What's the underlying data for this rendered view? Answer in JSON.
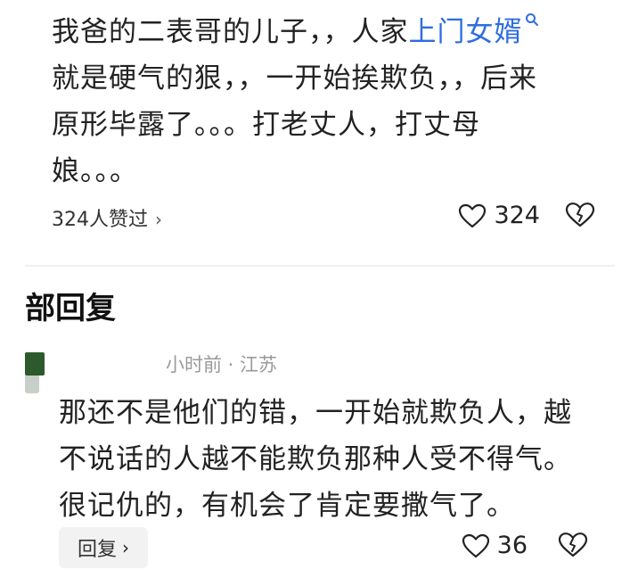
{
  "top_comment": {
    "line1": "我爸的二表哥的儿子，，人家",
    "link": "上门女婿",
    "line2": "就是硬气的狠，，一开始挨欺负，，后来",
    "line3": "原形毕露了。。。打老丈人，打丈母",
    "line4": "娘。。。",
    "likers_label": "324人赞过",
    "likes_count": "324"
  },
  "section_title": "部回复",
  "reply": {
    "meta": "小时前 · 江苏",
    "line1": "那还不是他们的错，一开始就欺负人，越",
    "line2": "不说话的人越不能欺负那种人受不得气。",
    "line3": "很记仇的，有机会了肯定要撒气了。",
    "reply_button": "回复",
    "likes_count": "36"
  },
  "colors": {
    "link": "#2f6de0",
    "text": "#222222",
    "muted": "#9a9a9a"
  },
  "icons": {
    "link_icon": "search-icon",
    "like_icon": "heart-icon",
    "dislike_icon": "broken-heart-icon",
    "chevron": "chevron-right-icon"
  }
}
